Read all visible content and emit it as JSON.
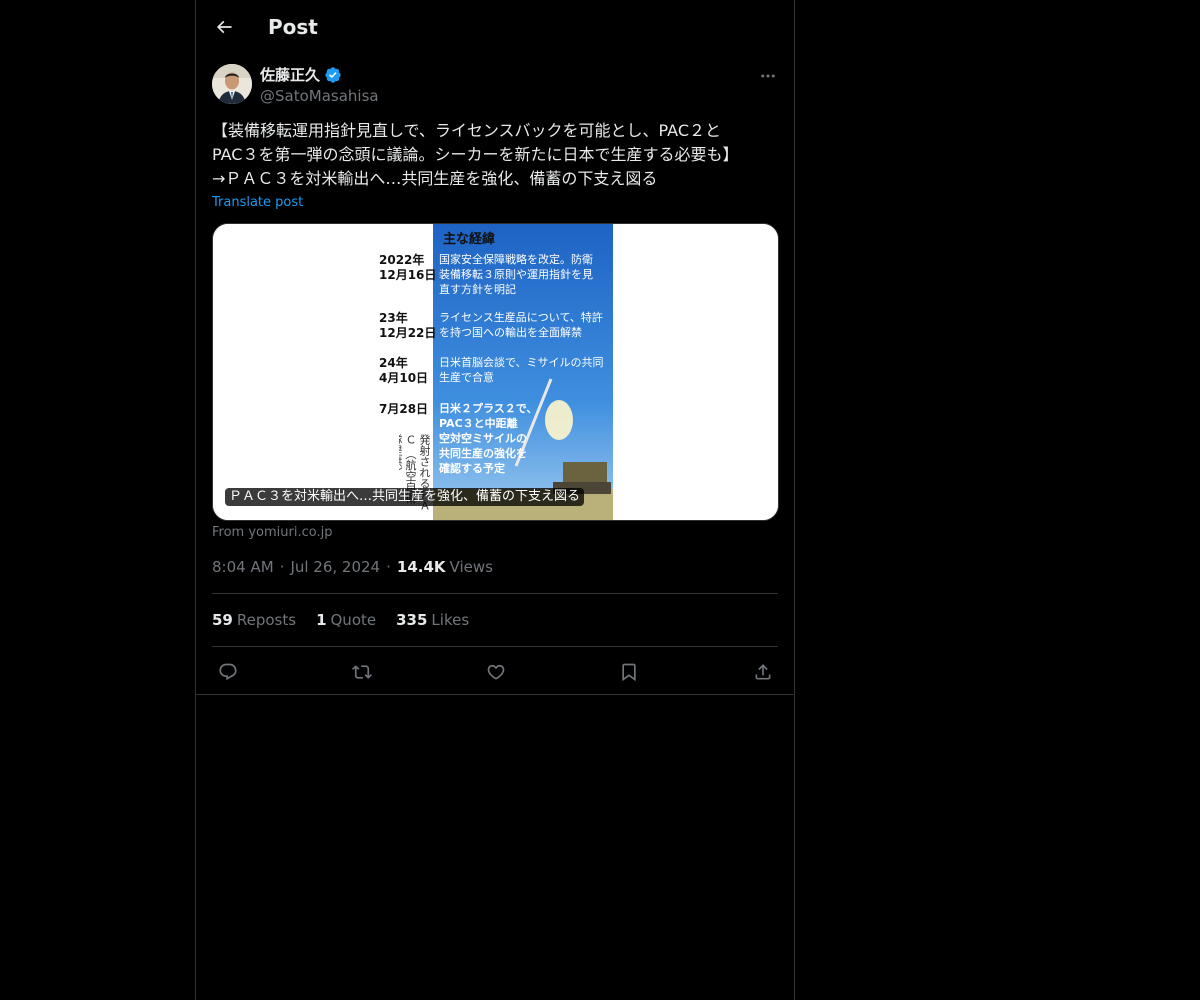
{
  "header": {
    "back_icon": "arrow-left-icon",
    "title": "Post"
  },
  "post": {
    "author": {
      "name": "佐藤正久",
      "handle": "@SatoMasahisa",
      "verified": true,
      "verified_color": "#1d9bf0"
    },
    "more_icon": "more-dots-icon",
    "text": "【装備移転運用指針見直しで、ライセンスバックを可能とし、PAC２と\nPAC３を第一弾の念頭に議論。シーカーを新たに日本で生産する必要も】\n→ＰＡＣ３を対米輸出へ…共同生産を強化、備蓄の下支え図る",
    "translate_label": "Translate post",
    "link_card": {
      "caption": "ＰＡＣ３を対米輸出へ…共同生産を強化、備蓄の下支え図る",
      "source": "From yomiuri.co.jp",
      "image": {
        "heading": "主な経緯",
        "timeline": [
          {
            "year": "2022年",
            "date": "12月16日",
            "text": [
              "国家安全保障戦略を改定。防衛",
              "装備移転３原則や運用指針を見",
              "直す方針を明記"
            ]
          },
          {
            "year": "23年",
            "date": "12月22日",
            "text": [
              "ライセンス生産品について、特許",
              "を持つ国への輸出を全面解禁"
            ]
          },
          {
            "year": "24年",
            "date": "4月10日",
            "text": [
              "日米首脳会談で、ミサイルの共同",
              "生産で合意"
            ]
          },
          {
            "year": "",
            "date": "7月28日",
            "text": [
              "日米２プラス２で、",
              "PAC３と中距離",
              "空対空ミサイルの",
              "共同生産の強化を",
              "確認する予定"
            ]
          }
        ],
        "vertical_caption": [
          "発射されるＰＡＣ",
          "（航空自衛隊提供）"
        ]
      }
    },
    "time": "8:04 AM",
    "date": "Jul 26, 2024",
    "views_count": "14.4K",
    "views_label": "Views",
    "stats": {
      "reposts_count": "59",
      "reposts_label": "Reposts",
      "quotes_count": "1",
      "quotes_label": "Quote",
      "likes_count": "335",
      "likes_label": "Likes"
    },
    "actions": [
      "reply-icon",
      "repost-icon",
      "like-icon",
      "bookmark-icon",
      "share-icon"
    ]
  },
  "colors": {
    "background": "#000000",
    "text_primary": "#e7e9ea",
    "text_secondary": "#71767b",
    "accent": "#1d9bf0",
    "border": "#2f3336"
  }
}
